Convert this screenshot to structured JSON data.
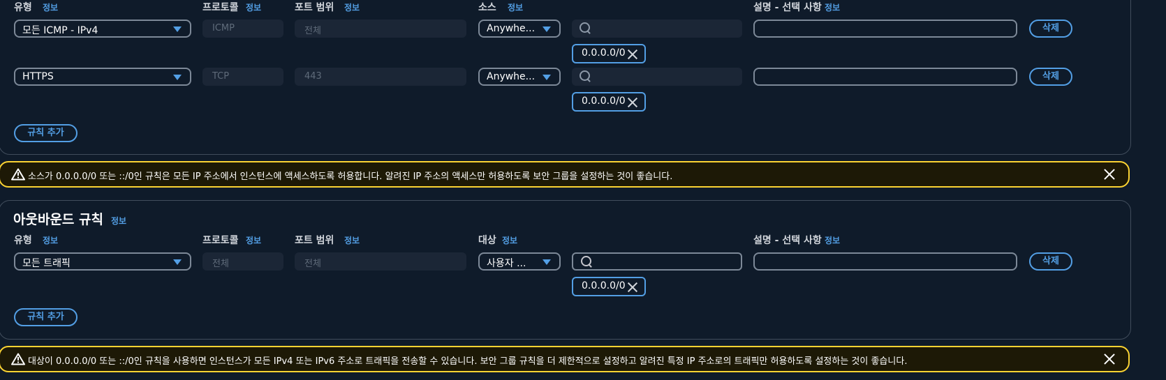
{
  "inbound": {
    "headers": {
      "type": "유형",
      "protocol": "프로토콜",
      "port_range": "포트 범위",
      "source": "소스",
      "description": "설명 - 선택 사항",
      "info": "정보"
    },
    "rules": [
      {
        "type": "모든 ICMP - IPv4",
        "protocol": "ICMP",
        "port_range": "전체",
        "source": "Anywhe...",
        "token": "0.0.0.0/0",
        "delete_label": "삭제"
      },
      {
        "type": "HTTPS",
        "protocol": "TCP",
        "port_range": "443",
        "source": "Anywhe...",
        "token": "0.0.0.0/0",
        "delete_label": "삭제"
      }
    ],
    "add_rule_label": "규칙 추가"
  },
  "alert_inbound": {
    "message": "소스가 0.0.0.0/0 또는 ::/0인 규칙은 모든 IP 주소에서 인스턴스에 액세스하도록 허용합니다. 알려진 IP 주소의 액세스만 허용하도록 보안 그룹을 설정하는 것이 좋습니다."
  },
  "outbound": {
    "title": "아웃바운드 규칙",
    "title_info": "정보",
    "headers": {
      "type": "유형",
      "protocol": "프로토콜",
      "port_range": "포트 범위",
      "destination": "대상",
      "description": "설명 - 선택 사항",
      "info": "정보"
    },
    "rules": [
      {
        "type": "모든 트래픽",
        "protocol": "전체",
        "port_range": "전체",
        "destination": "사용자 ...",
        "token": "0.0.0.0/0",
        "delete_label": "삭제"
      }
    ],
    "add_rule_label": "규칙 추가"
  },
  "alert_outbound": {
    "message": "대상이 0.0.0.0/0 또는 ::/0인 규칙을 사용하면 인스턴스가 모든 IPv4 또는 IPv6 주소로 트래픽을 전송할 수 있습니다. 보안 그룹 규칙을 더 제한적으로 설정하고 알려진 특정 IP 주소로의 트래픽만 허용하도록 설정하는 것이 좋습니다."
  },
  "colors": {
    "accent": "#539fe5",
    "warning": "#fbd332",
    "background": "#0f1b2a"
  }
}
